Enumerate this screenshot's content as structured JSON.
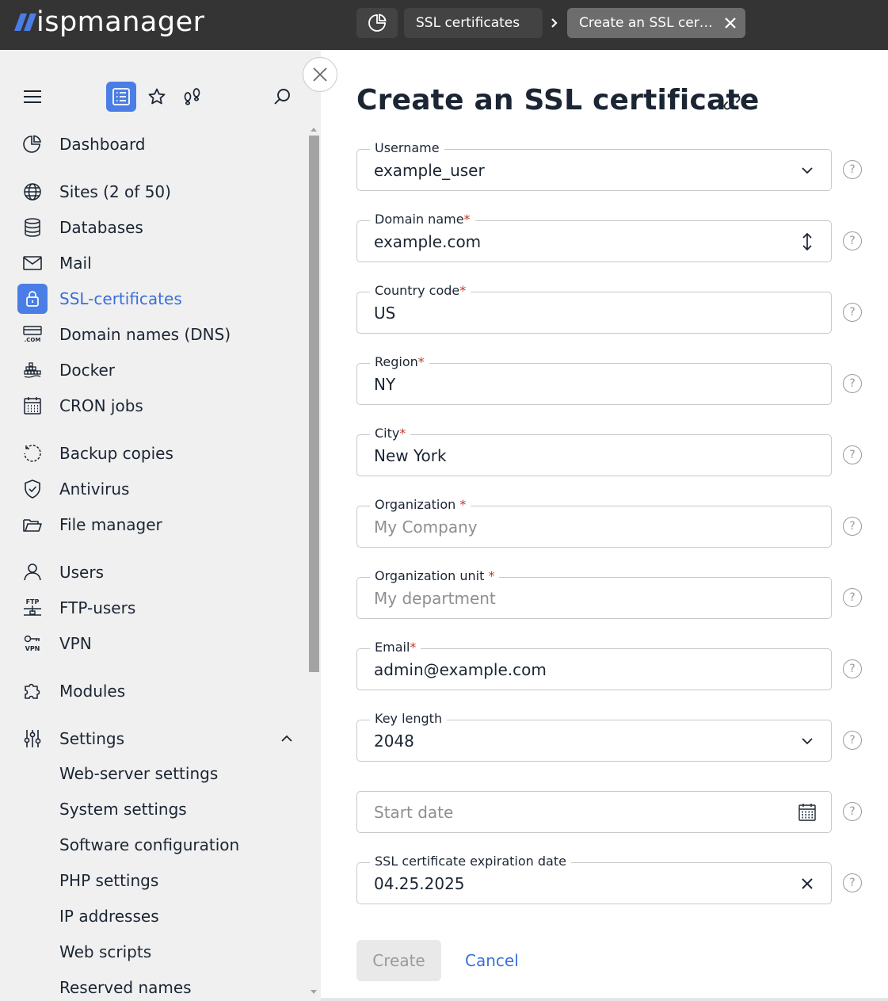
{
  "app": {
    "brand": "ispmanager",
    "accent_color": "#4a7ee6",
    "topbar_color": "#343434"
  },
  "tabs": [
    {
      "label": "SSL certificates"
    },
    {
      "label": "Create an SSL certificate"
    }
  ],
  "sidebar": {
    "toolbar": {
      "menu_icon": "hamburger-icon",
      "list_icon": "list-icon",
      "favorites_icon": "star-icon",
      "footprints_icon": "footprints-icon",
      "search_icon": "search-icon"
    },
    "items": [
      {
        "label": "Dashboard",
        "icon": "pie-chart-icon"
      },
      {
        "label": "Sites (2 of 50)",
        "icon": "globe-icon"
      },
      {
        "label": "Databases",
        "icon": "database-icon"
      },
      {
        "label": "Mail",
        "icon": "mail-icon"
      },
      {
        "label": "SSL-certificates",
        "icon": "lock-icon"
      },
      {
        "label": "Domain names (DNS)",
        "icon": "dns-icon"
      },
      {
        "label": "Docker",
        "icon": "docker-icon"
      },
      {
        "label": "CRON jobs",
        "icon": "calendar-icon"
      },
      {
        "label": "Backup copies",
        "icon": "backup-icon"
      },
      {
        "label": "Antivirus",
        "icon": "shield-icon"
      },
      {
        "label": "File manager",
        "icon": "folder-icon"
      },
      {
        "label": "Users",
        "icon": "user-icon"
      },
      {
        "label": "FTP-users",
        "icon": "ftp-icon"
      },
      {
        "label": "VPN",
        "icon": "vpn-icon"
      },
      {
        "label": "Modules",
        "icon": "puzzle-icon"
      },
      {
        "label": "Settings",
        "icon": "sliders-icon"
      }
    ],
    "ftp_badge": "FTP",
    "vpn_badge": "VPN",
    "dns_badge": ".COM",
    "settings_sub": [
      {
        "label": "Web-server settings"
      },
      {
        "label": "System settings"
      },
      {
        "label": "Software configuration"
      },
      {
        "label": "PHP settings"
      },
      {
        "label": "IP addresses"
      },
      {
        "label": "Web scripts"
      },
      {
        "label": "Reserved names"
      }
    ]
  },
  "form": {
    "title": "Create an SSL certificate",
    "fields": [
      {
        "label": "Username",
        "required": "",
        "value": "example_user",
        "placeholder": "",
        "control": "dropdown"
      },
      {
        "label": "Domain name",
        "required": "*",
        "value": "example.com",
        "placeholder": "",
        "control": "updown"
      },
      {
        "label": "Country code",
        "required": "*",
        "value": "US",
        "placeholder": "",
        "control": "text"
      },
      {
        "label": "Region",
        "required": "*",
        "value": "NY",
        "placeholder": "",
        "control": "text"
      },
      {
        "label": "City",
        "required": "*",
        "value": "New York",
        "placeholder": "",
        "control": "text"
      },
      {
        "label": "Organization ",
        "required": "*",
        "value": "",
        "placeholder": "My Company",
        "control": "text"
      },
      {
        "label": "Organization unit ",
        "required": "*",
        "value": "",
        "placeholder": "My department",
        "control": "text"
      },
      {
        "label": "Email",
        "required": "*",
        "value": "admin@example.com",
        "placeholder": "",
        "control": "text"
      },
      {
        "label": "Key length",
        "required": "",
        "value": "2048",
        "placeholder": "",
        "control": "dropdown"
      },
      {
        "label": "",
        "required": "",
        "value": "",
        "placeholder": "Start date",
        "control": "calendar"
      },
      {
        "label": "SSL certificate expiration date",
        "required": "",
        "value": "04.25.2025",
        "placeholder": "",
        "control": "clear"
      }
    ],
    "help_glyph": "?",
    "create_label": "Create",
    "cancel_label": "Cancel"
  }
}
